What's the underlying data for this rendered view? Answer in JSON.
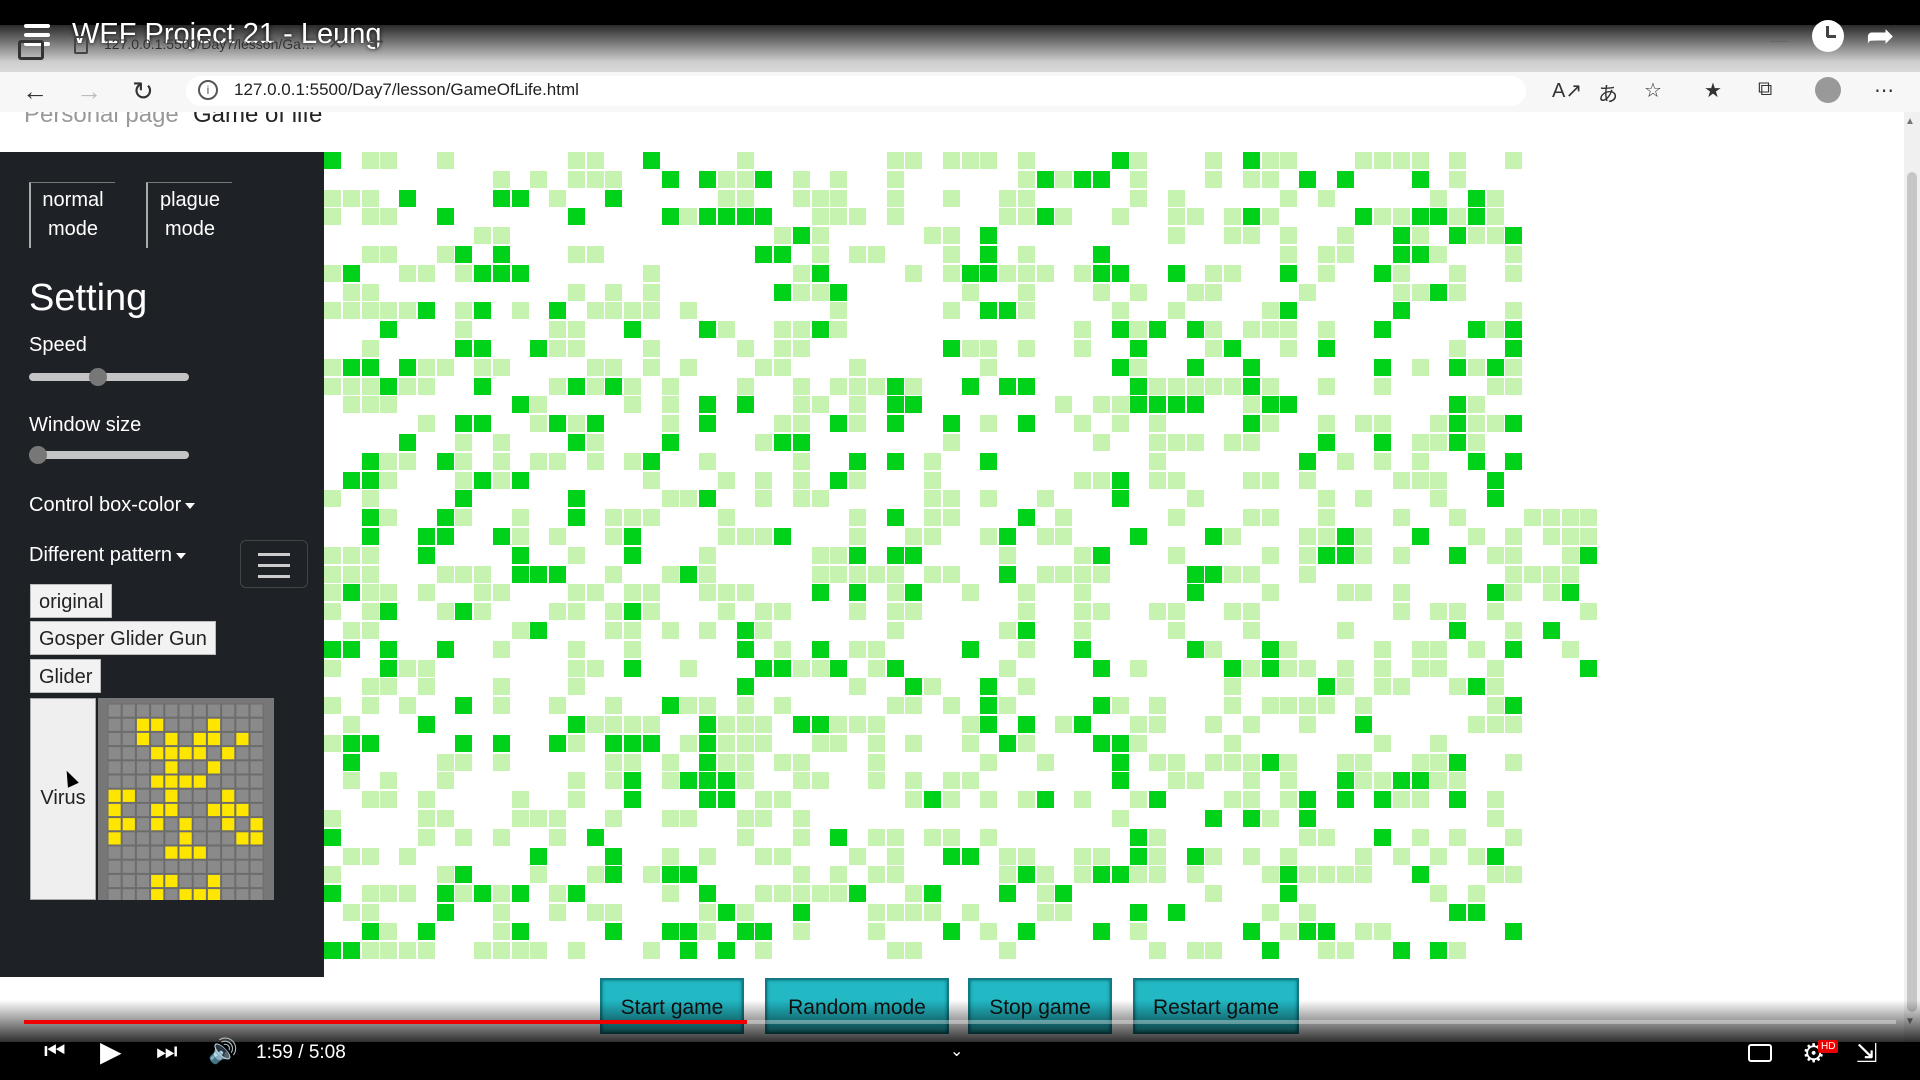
{
  "player": {
    "title": "WEF Project 21 - Leung",
    "time": "1:59 / 5:08",
    "progress": 0.386
  },
  "browser": {
    "tab_title": "127.0.0.1:5500/Day7/lesson/Ga…",
    "url": "127.0.0.1:5500/Day7/lesson/GameOfLife.html"
  },
  "nav": {
    "personal": "Personal page",
    "game": "Game of life"
  },
  "sidebar": {
    "normal_mode": "normal mode",
    "plague_mode": "plague mode",
    "setting": "Setting",
    "speed_label": "Speed",
    "speed_value": 0.42,
    "window_label": "Window size",
    "window_value": 0.0,
    "color_dropdown": "Control box-color",
    "pattern_dropdown": "Different pattern",
    "patterns": [
      "original",
      "Gosper Glider Gun",
      "Glider",
      "Virus"
    ]
  },
  "buttons": {
    "start": "Start game",
    "random": "Random mode",
    "stop": "Stop game",
    "restart": "Restart game"
  },
  "colors": {
    "alive": "#00d21a",
    "dead_trail": "#c6f3b0",
    "button": "#22b8c4",
    "sidebar": "#1e2226",
    "virus_cell": "#ffe600"
  }
}
